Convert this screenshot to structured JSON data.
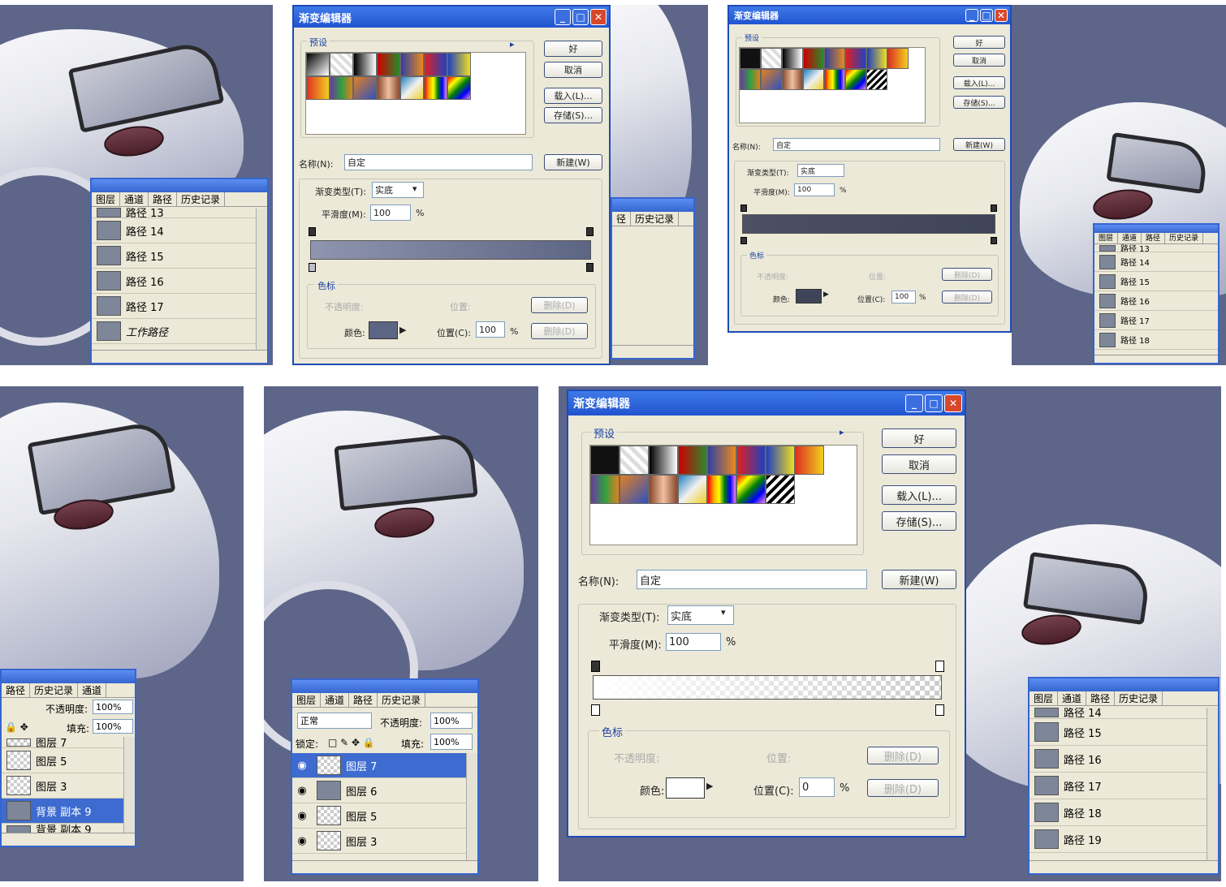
{
  "dialog_large": {
    "title": "渐变编辑器",
    "preset_label": "预设",
    "ok": "好",
    "cancel": "取消",
    "load": "载入(L)...",
    "save": "存储(S)...",
    "name_label": "名称(N):",
    "name_value": "自定",
    "new_button": "新建(W)",
    "type_label": "渐变类型(T):",
    "type_value": "实底",
    "smooth_label": "平滑度(M):",
    "smooth_value": "100",
    "percent": "%",
    "stops_label": "色标",
    "opacity_label": "不透明度:",
    "position_label": "位置:",
    "delete_label": "删除(D)",
    "color_label": "颜色:",
    "position_c_label": "位置(C):",
    "position_c_value": "0"
  },
  "dialog_a": {
    "title": "渐变编辑器",
    "preset_label": "预设",
    "ok": "好",
    "cancel": "取消",
    "load": "载入(L)...",
    "save": "存储(S)...",
    "name_label": "名称(N):",
    "name_value": "自定",
    "new_button": "新建(W)",
    "type_label": "渐变类型(T):",
    "type_value": "实底",
    "smooth_label": "平滑度(M):",
    "smooth_value": "100",
    "percent": "%",
    "stops_label": "色标",
    "opacity_label": "不透明度:",
    "position_label": "位置:",
    "delete_label": "删除(D)",
    "color_label": "颜色:",
    "position_c_label": "位置(C):",
    "position_c_value": "100"
  },
  "dialog_b": {
    "title": "渐变编辑器",
    "preset_label": "预设",
    "ok": "好",
    "cancel": "取消",
    "load": "载入(L)...",
    "save": "存储(S)...",
    "name_label": "名称(N):",
    "name_value": "自定",
    "new_button": "新建(W)",
    "type_label": "渐变类型(T):",
    "type_value": "实底",
    "smooth_label": "平滑度(M):",
    "smooth_value": "100",
    "percent": "%",
    "stops_label": "色标",
    "opacity_label": "不透明度:",
    "position_label": "位置:",
    "delete_label": "删除(D)",
    "color_label": "颜色:",
    "position_c_label": "位置(C):",
    "position_c_value": "100"
  },
  "tabs_full": [
    "图层",
    "通道",
    "路径",
    "历史记录"
  ],
  "tabs_hist": [
    "径",
    "历史记录"
  ],
  "tabs_bl": [
    "路径",
    "历史记录",
    "通道"
  ],
  "paths_a": [
    "路径 13",
    "路径 14",
    "路径 15",
    "路径 16",
    "路径 17",
    "工作路径"
  ],
  "paths_b": [
    "路径 13",
    "路径 14",
    "路径 15",
    "路径 16",
    "路径 17",
    "路径 18"
  ],
  "paths_c": [
    "路径 14",
    "路径 15",
    "路径 16",
    "路径 17",
    "路径 18",
    "路径 19"
  ],
  "layers_bl": {
    "opacity_label": "不透明度:",
    "opacity_value": "100%",
    "fill_label": "填充:",
    "fill_value": "100%",
    "rows": [
      "图层 7",
      "图层 5",
      "图层 3",
      "背景 副本 9",
      "背景 副本 9"
    ]
  },
  "layers_bm": {
    "mode": "正常",
    "opacity_label": "不透明度:",
    "opacity_value": "100%",
    "lock_label": "锁定:",
    "fill_label": "填充:",
    "fill_value": "100%",
    "rows": [
      "图层 7",
      "图层 6",
      "图层 5",
      "图层 3"
    ]
  },
  "colors": {
    "background": "#5d6688",
    "xp_blue": "#2154d0",
    "dialog_face": "#ece9d8",
    "stop_color_a": "#5c6584",
    "stop_color_b": "#3f4458"
  }
}
